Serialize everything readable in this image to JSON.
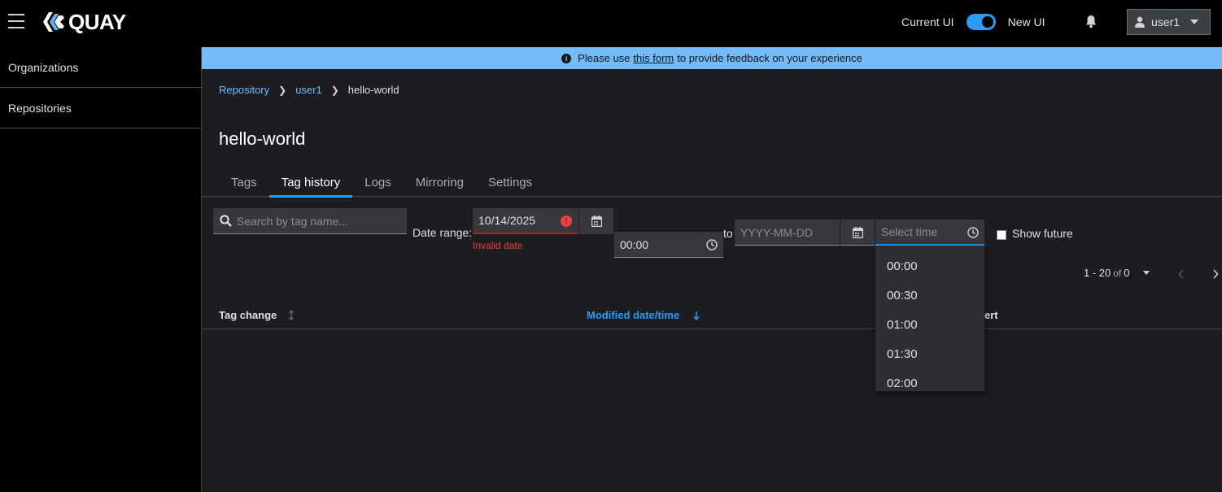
{
  "header": {
    "logo_text": "QUAY",
    "ui_toggle": {
      "current_label": "Current UI",
      "new_label": "New UI",
      "enabled": true
    },
    "user": "user1"
  },
  "sidebar": {
    "items": [
      {
        "label": "Organizations"
      },
      {
        "label": "Repositories"
      }
    ]
  },
  "banner": {
    "prefix": "Please use",
    "link": "this form",
    "suffix": "to provide feedback on your experience"
  },
  "breadcrumb": [
    {
      "label": "Repository"
    },
    {
      "label": "user1"
    },
    {
      "label": "hello-world"
    }
  ],
  "page_title": "hello-world",
  "tabs": [
    {
      "label": "Tags"
    },
    {
      "label": "Tag history",
      "active": true
    },
    {
      "label": "Logs"
    },
    {
      "label": "Mirroring"
    },
    {
      "label": "Settings"
    }
  ],
  "filters": {
    "search_placeholder": "Search by tag name...",
    "date_range_label": "Date range:",
    "start_date_value": "10/14/2025",
    "start_date_error": "Invalid date",
    "start_time_value": "00:00",
    "to_label": "to",
    "end_date_placeholder": "YYYY-MM-DD",
    "end_time_placeholder": "Select time",
    "show_future_label": "Show future"
  },
  "time_options": [
    "00:00",
    "00:30",
    "01:00",
    "01:30",
    "02:00"
  ],
  "pagination": {
    "range": "1 - 20",
    "of": "of",
    "total": "0"
  },
  "table": {
    "columns": [
      "Tag change",
      "Modified date/time",
      "ert"
    ]
  },
  "colors": {
    "accent": "#2b9af3",
    "error": "#c9190b",
    "banner": "#73bcf7"
  }
}
